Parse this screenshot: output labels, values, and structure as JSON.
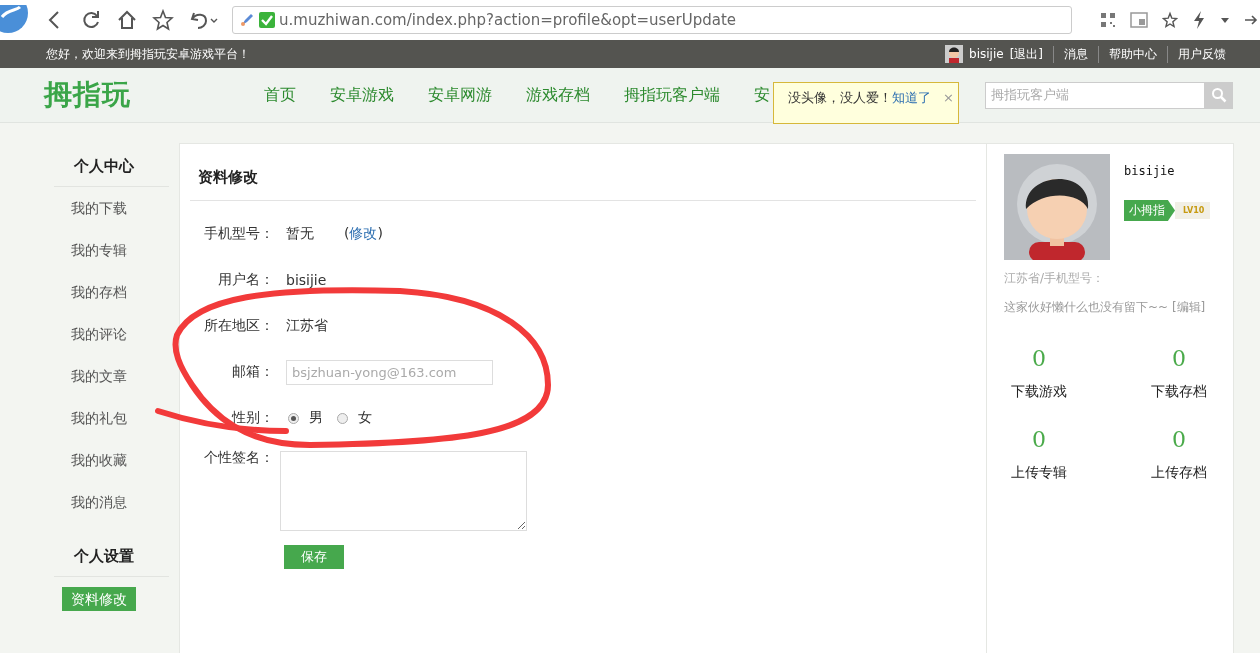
{
  "browser": {
    "url": "u.muzhiwan.com/index.php?action=profile&opt=userUpdate"
  },
  "top_bar": {
    "welcome": "您好，欢迎来到拇指玩安卓游戏平台！",
    "username": "bisijie",
    "logout": "[退出]",
    "links": [
      "消息",
      "帮助中心",
      "用户反馈"
    ]
  },
  "header": {
    "logo": "拇指玩",
    "nav": [
      "首页",
      "安卓游戏",
      "安卓网游",
      "游戏存档",
      "拇指玩客户端",
      "安"
    ],
    "search": {
      "placeholder": "拇指玩客户端"
    }
  },
  "tooltip": {
    "text": "没头像，没人爱！",
    "link": "知道了",
    "close": "×"
  },
  "sidebar": {
    "sections": [
      {
        "title": "个人中心",
        "items": [
          {
            "label": "我的下载",
            "selected": false
          },
          {
            "label": "我的专辑",
            "selected": false
          },
          {
            "label": "我的存档",
            "selected": false
          },
          {
            "label": "我的评论",
            "selected": false
          },
          {
            "label": "我的文章",
            "selected": false
          },
          {
            "label": "我的礼包",
            "selected": false
          },
          {
            "label": "我的收藏",
            "selected": false
          },
          {
            "label": "我的消息",
            "selected": false
          }
        ]
      },
      {
        "title": "个人设置",
        "items": [
          {
            "label": "资料修改",
            "selected": true
          }
        ]
      }
    ]
  },
  "form": {
    "title": "资料修改",
    "fields": [
      {
        "kind": "text",
        "label": "手机型号：",
        "value": "暂无",
        "before": "(",
        "link": "修改",
        "after": ")"
      },
      {
        "kind": "text",
        "label": "用户名：",
        "value": "bisijie"
      },
      {
        "kind": "text",
        "label": "所在地区：",
        "value": "江苏省"
      },
      {
        "kind": "input",
        "label": "邮箱：",
        "value": "bsjzhuan-yong@163.com",
        "disabled": true
      },
      {
        "kind": "radio",
        "label": "性别：",
        "options": [
          {
            "label": "男",
            "selected": true
          },
          {
            "label": "女",
            "selected": false
          }
        ]
      },
      {
        "kind": "textarea",
        "label": "个性签名："
      }
    ],
    "button": "保存"
  },
  "profile": {
    "username": "bisijie",
    "badge": "小拇指",
    "level": "LV10",
    "location": "江苏省/手机型号：",
    "bio": "这家伙好懒什么也没有留下~~",
    "edit": "[编辑]",
    "stats": [
      {
        "value": "0",
        "label": "下载游戏"
      },
      {
        "value": "0",
        "label": "下载存档"
      },
      {
        "value": "0",
        "label": "上传专辑"
      },
      {
        "value": "0",
        "label": "上传存档"
      }
    ]
  },
  "annotation": {
    "kind": "circle"
  }
}
